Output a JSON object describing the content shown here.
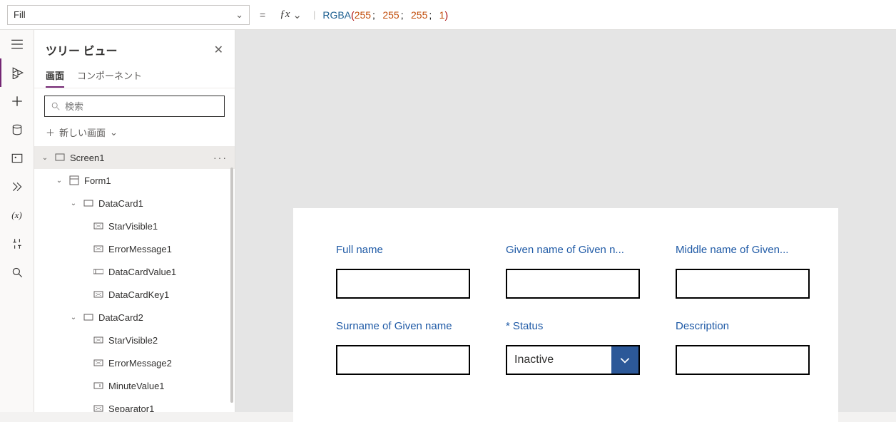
{
  "topbar": {
    "property": "Fill",
    "formula": {
      "func": "RGBA",
      "args": [
        "255",
        "255",
        "255",
        "1"
      ]
    }
  },
  "tree": {
    "title": "ツリー ビュー",
    "tabs": {
      "screens": "画面",
      "components": "コンポーネント"
    },
    "search_placeholder": "検索",
    "new_screen": "新しい画面",
    "items": {
      "screen": "Screen1",
      "form": "Form1",
      "dc1": "DataCard1",
      "sv1": "StarVisible1",
      "em1": "ErrorMessage1",
      "dcv1": "DataCardValue1",
      "dck1": "DataCardKey1",
      "dc2": "DataCard2",
      "sv2": "StarVisible2",
      "em2": "ErrorMessage2",
      "mv1": "MinuteValue1",
      "sep1": "Separator1"
    }
  },
  "form": {
    "full_name": "Full name",
    "given_name": "Given name of Given n...",
    "middle_name": "Middle name of Given...",
    "surname": "Surname of Given name",
    "status": "Status",
    "status_value": "Inactive",
    "description": "Description"
  }
}
